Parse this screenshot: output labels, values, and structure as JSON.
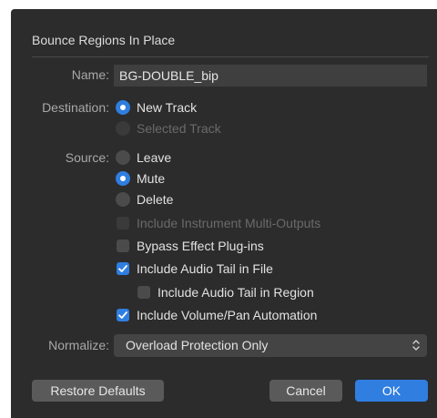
{
  "dialog": {
    "title": "Bounce Regions In Place",
    "name_label": "Name:",
    "name_value": "BG-DOUBLE_bip",
    "destination_label": "Destination:",
    "destination_options": [
      {
        "label": "New Track",
        "selected": true,
        "enabled": true
      },
      {
        "label": "Selected Track",
        "selected": false,
        "enabled": false
      }
    ],
    "source_label": "Source:",
    "source_options": [
      {
        "label": "Leave",
        "selected": false
      },
      {
        "label": "Mute",
        "selected": true
      },
      {
        "label": "Delete",
        "selected": false
      }
    ],
    "checkboxes": [
      {
        "label": "Include Instrument Multi-Outputs",
        "checked": false,
        "enabled": false
      },
      {
        "label": "Bypass Effect Plug-ins",
        "checked": false,
        "enabled": true
      },
      {
        "label": "Include Audio Tail in File",
        "checked": true,
        "enabled": true
      },
      {
        "label": "Include Audio Tail in Region",
        "checked": false,
        "enabled": true
      },
      {
        "label": "Include Volume/Pan Automation",
        "checked": true,
        "enabled": true
      }
    ],
    "normalize_label": "Normalize:",
    "normalize_value": "Overload Protection Only",
    "buttons": {
      "restore": "Restore Defaults",
      "cancel": "Cancel",
      "ok": "OK"
    },
    "colors": {
      "background": "#2c2c2c",
      "accent": "#2f7ee0"
    }
  }
}
